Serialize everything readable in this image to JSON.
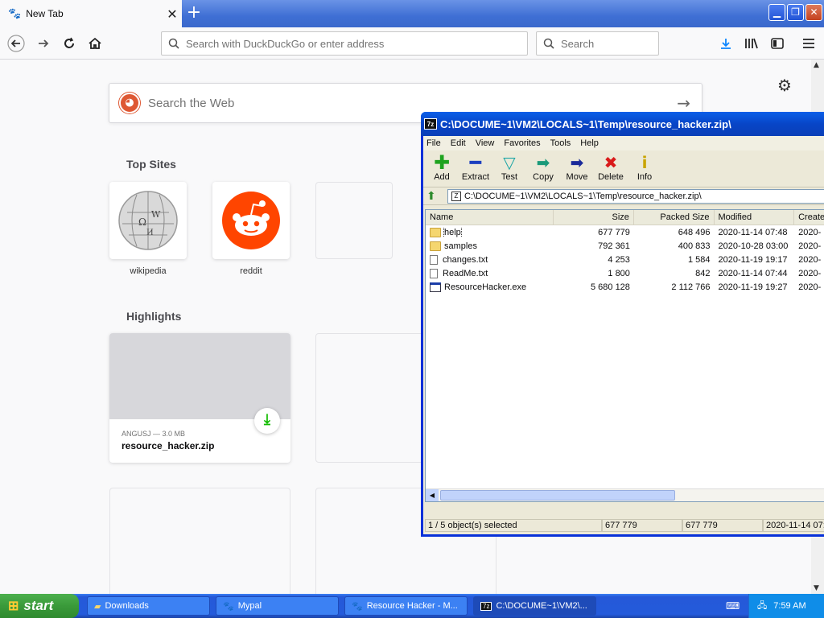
{
  "browser": {
    "tab": {
      "title": "New Tab"
    },
    "new_tab_symbol": "+",
    "address_placeholder": "Search with DuckDuckGo or enter address",
    "search_placeholder": "Search",
    "web_search_placeholder": "Search the Web"
  },
  "newtab": {
    "top_sites_title": "Top Sites",
    "top_sites": [
      {
        "label": "wikipedia"
      },
      {
        "label": "reddit"
      }
    ],
    "highlights_title": "Highlights",
    "highlight": {
      "meta": "ANGUSJ — 3.0 MB",
      "title": "resource_hacker.zip"
    }
  },
  "sevenzip": {
    "title": "C:\\DOCUME~1\\VM2\\LOCALS~1\\Temp\\resource_hacker.zip\\",
    "menu": [
      "File",
      "Edit",
      "View",
      "Favorites",
      "Tools",
      "Help"
    ],
    "tools": [
      {
        "label": "Add",
        "icon": "add-icon",
        "color": "#1fa31f"
      },
      {
        "label": "Extract",
        "icon": "extract-icon",
        "color": "#1c3fbf"
      },
      {
        "label": "Test",
        "icon": "test-icon",
        "color": "#1aa5a5"
      },
      {
        "label": "Copy",
        "icon": "copy-icon",
        "color": "#1a9a7a"
      },
      {
        "label": "Move",
        "icon": "move-icon",
        "color": "#1a2a9a"
      },
      {
        "label": "Delete",
        "icon": "delete-icon",
        "color": "#d91a1a"
      },
      {
        "label": "Info",
        "icon": "info-icon",
        "color": "#c9a400"
      }
    ],
    "path": "C:\\DOCUME~1\\VM2\\LOCALS~1\\Temp\\resource_hacker.zip\\",
    "columns": [
      "Name",
      "Size",
      "Packed Size",
      "Modified",
      "Created"
    ],
    "files": [
      {
        "name": "help",
        "type": "folder",
        "size": "677 779",
        "packed": "648 496",
        "modified": "2020-11-14 07:48",
        "created": "2020-"
      },
      {
        "name": "samples",
        "type": "folder",
        "size": "792 361",
        "packed": "400 833",
        "modified": "2020-10-28 03:00",
        "created": "2020-"
      },
      {
        "name": "changes.txt",
        "type": "txt",
        "size": "4 253",
        "packed": "1 584",
        "modified": "2020-11-19 19:17",
        "created": "2020-"
      },
      {
        "name": "ReadMe.txt",
        "type": "txt",
        "size": "1 800",
        "packed": "842",
        "modified": "2020-11-14 07:44",
        "created": "2020-"
      },
      {
        "name": "ResourceHacker.exe",
        "type": "exe",
        "size": "5 680 128",
        "packed": "2 112 766",
        "modified": "2020-11-19 19:27",
        "created": "2020-"
      }
    ],
    "status": {
      "selection": "1 / 5 object(s) selected",
      "size": "677 779",
      "packed": "677 779",
      "modified": "2020-11-14 07:"
    }
  },
  "taskbar": {
    "start_label": "start",
    "tasks": [
      {
        "label": "Downloads",
        "icon": "folder-icon"
      },
      {
        "label": "Mypal",
        "icon": "mypal-icon"
      },
      {
        "label": "Resource Hacker - M...",
        "icon": "mypal-icon"
      },
      {
        "label": "C:\\DOCUME~1\\VM2\\...",
        "icon": "7zip-icon"
      }
    ],
    "clock": "7:59 AM"
  },
  "colors": {
    "xp_blue": "#245bdb",
    "start_green": "#3a9a3a",
    "ddg_orange": "#de5833",
    "reddit_orange": "#ff4500"
  }
}
